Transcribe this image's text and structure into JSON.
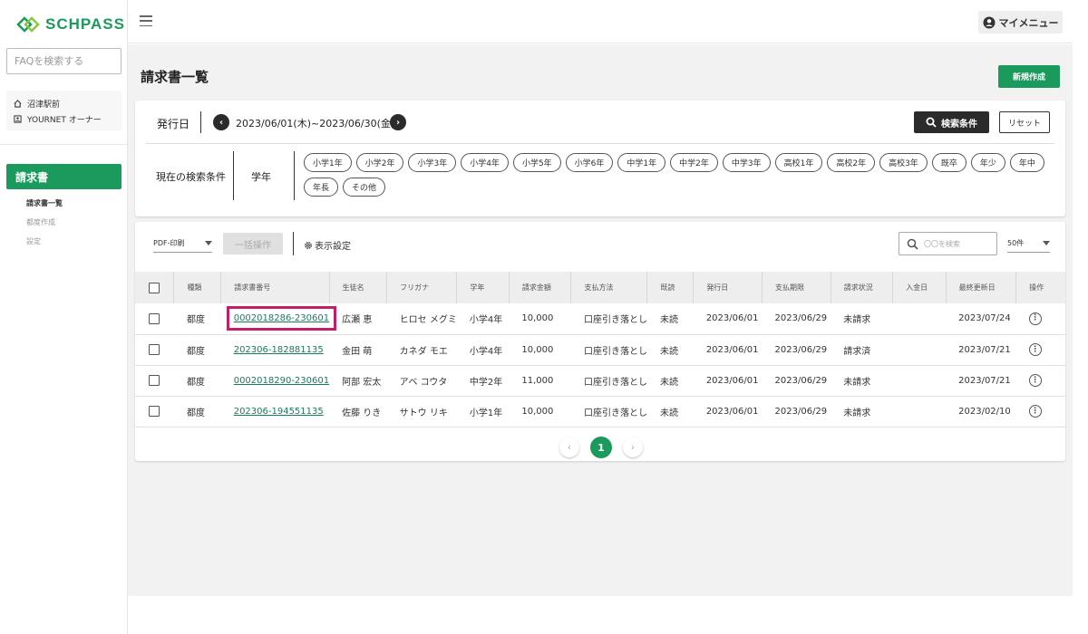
{
  "brand": {
    "name": "SCHPASS",
    "accent": "#1a9a5c"
  },
  "sidebar": {
    "faq_placeholder": "FAQを検索する",
    "store": {
      "name": "沼津駅前",
      "role": "YOURNET オーナー"
    },
    "nav_active": "請求書",
    "subnav": [
      "請求書一覧",
      "都度作成",
      "設定"
    ]
  },
  "header": {
    "mymenu": "マイメニュー"
  },
  "page": {
    "title": "請求書一覧",
    "new_button": "新規作成"
  },
  "filter": {
    "issue_date_label": "発行日",
    "date_range": "2023/06/01(木)~2023/06/30(金)",
    "search_button": "検索条件",
    "reset_button": "リセット",
    "current_label": "現在の検索条件",
    "grade_label": "学年",
    "chips": [
      "小学1年",
      "小学2年",
      "小学3年",
      "小学4年",
      "小学5年",
      "小学6年",
      "中学1年",
      "中学2年",
      "中学3年",
      "高校1年",
      "高校2年",
      "高校3年",
      "既卒",
      "年少",
      "年中",
      "年長",
      "その他"
    ]
  },
  "toolbar": {
    "pdf_select": "PDF-印刷",
    "bulk_button": "一括操作",
    "display_settings": "表示設定",
    "search_placeholder": "〇〇を検索",
    "per_page": "50件"
  },
  "table": {
    "columns": [
      "種類",
      "請求書番号",
      "生徒名",
      "フリガナ",
      "学年",
      "請求金額",
      "支払方法",
      "既読",
      "発行日",
      "支払期限",
      "請求状況",
      "入金日",
      "最終更新日",
      "操作"
    ],
    "rows": [
      {
        "type": "都度",
        "number": "0002018286-230601",
        "name": "広瀬 恵",
        "kana": "ヒロセ メグミ",
        "grade": "小学4年",
        "amount": "10,000",
        "method": "口座引き落とし",
        "read": "未読",
        "issued": "2023/06/01",
        "due": "2023/06/29",
        "status": "未請求",
        "paid": "",
        "updated": "2023/07/24"
      },
      {
        "type": "都度",
        "number": "202306-182881135",
        "name": "金田 萌",
        "kana": "カネダ モエ",
        "grade": "小学4年",
        "amount": "10,000",
        "method": "口座引き落とし",
        "read": "未読",
        "issued": "2023/06/01",
        "due": "2023/06/29",
        "status": "請求済",
        "paid": "",
        "updated": "2023/07/21"
      },
      {
        "type": "都度",
        "number": "0002018290-230601",
        "name": "阿部 宏太",
        "kana": "アベ コウタ",
        "grade": "中学2年",
        "amount": "11,000",
        "method": "口座引き落とし",
        "read": "未読",
        "issued": "2023/06/01",
        "due": "2023/06/29",
        "status": "未請求",
        "paid": "",
        "updated": "2023/07/21"
      },
      {
        "type": "都度",
        "number": "202306-194551135",
        "name": "佐藤 りき",
        "kana": "サトウ リキ",
        "grade": "小学1年",
        "amount": "10,000",
        "method": "口座引き落とし",
        "read": "未読",
        "issued": "2023/06/01",
        "due": "2023/06/29",
        "status": "未請求",
        "paid": "",
        "updated": "2023/02/10"
      }
    ]
  },
  "pager": {
    "current": "1"
  }
}
